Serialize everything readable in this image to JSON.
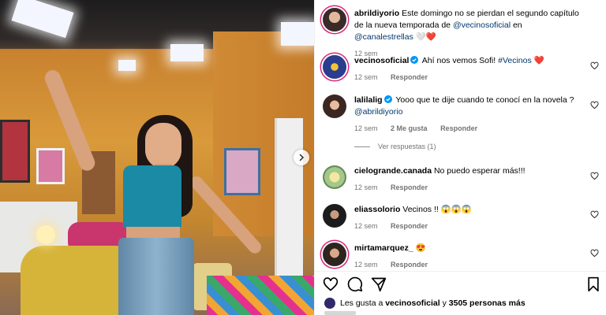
{
  "post": {
    "caption": {
      "username": "abrildiyorio",
      "text": "Este domingo no se pierdan el segundo capítulo de la nueva temporada de",
      "mention1": "@vecinosoficial",
      "mid": "en",
      "mention2": "@canalestrellas",
      "emoji": "🤍❤️",
      "time": "12 sem"
    },
    "comments": [
      {
        "username": "vecinosoficial",
        "verified": true,
        "text": "Ahí nos vemos Sofi!",
        "hashtag": "#Vecinos",
        "emoji": "❤️",
        "time": "12 sem",
        "reply_label": "Responder"
      },
      {
        "username": "lalilalig",
        "verified": true,
        "text": "Yooo que te dije cuando te conocí en la novela ?",
        "mention": "@abrildiyorio",
        "time": "12 sem",
        "likes": "2 Me gusta",
        "reply_label": "Responder"
      },
      {
        "username": "cielogrande.canada",
        "text": "No puedo esperar más!!!",
        "time": "12 sem",
        "reply_label": "Responder"
      },
      {
        "username": "eliassolorio",
        "text": "Vecinos !!",
        "emoji": "😱😱😱",
        "time": "12 sem",
        "reply_label": "Responder"
      },
      {
        "username": "mirtamarquez_",
        "emoji": "😍",
        "time": "12 sem",
        "reply_label": "Responder"
      }
    ],
    "view_replies": "Ver respuestas (1)",
    "likes": {
      "prefix": "Les gusta a",
      "user": "vecinosoficial",
      "conj": "y",
      "count": "3505 personas más"
    }
  },
  "icons": {
    "like": "heart-icon",
    "comment": "comment-icon",
    "share": "share-icon",
    "save": "bookmark-icon",
    "next": "chevron-right-icon"
  },
  "colors": {
    "link": "#00376b",
    "meta": "#737373",
    "verified": "#0095f6",
    "heart": "#ff3040"
  }
}
